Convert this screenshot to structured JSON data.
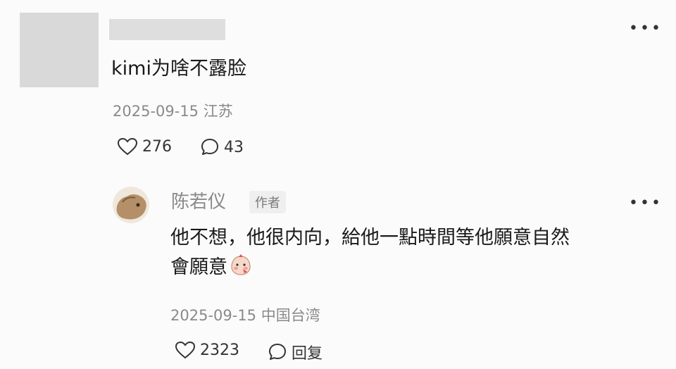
{
  "comment": {
    "text": "kimi为啥不露脸",
    "date": "2025-09-15",
    "location": "江苏",
    "likes": "276",
    "replies": "43"
  },
  "reply": {
    "author": "陈若仪",
    "badge": "作者",
    "text_line1": "他不想，他很内向，給他一點時間等他願意自然",
    "text_line2": "會願意",
    "date": "2025-09-15",
    "location": "中国台湾",
    "likes": "2323",
    "reply_label": "回复"
  },
  "icons": {
    "more": "more-horizontal-icon",
    "like": "heart-icon",
    "comment": "speech-bubble-icon"
  }
}
